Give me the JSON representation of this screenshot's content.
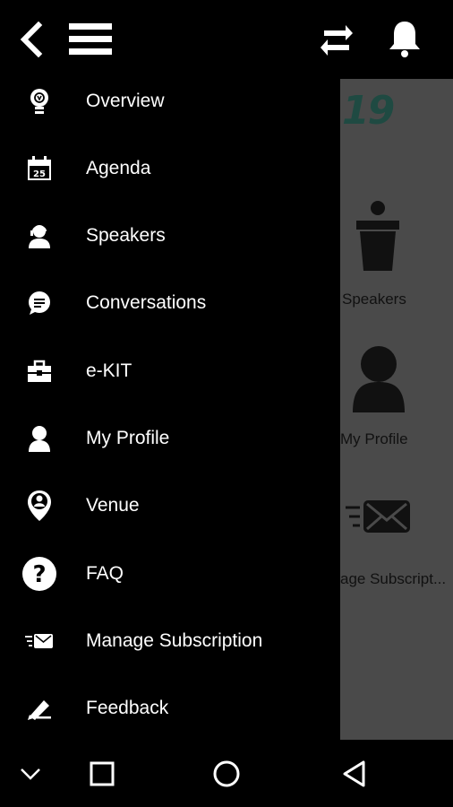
{
  "colors": {
    "background": "#000000",
    "drawer": "#000000",
    "overlay_content": "#4a4a4a",
    "text": "#ffffff",
    "accent_logo": "#1f4a42"
  },
  "topbar": {
    "icons": [
      "back-arrow-icon",
      "hamburger-menu-icon",
      "sync-icon",
      "bell-icon"
    ]
  },
  "drawer": {
    "items": [
      {
        "label": "Overview",
        "icon": "lightbulb-icon"
      },
      {
        "label": "Agenda",
        "icon": "calendar-icon"
      },
      {
        "label": "Speakers",
        "icon": "speaker-icon"
      },
      {
        "label": "Conversations",
        "icon": "chat-bubble-icon"
      },
      {
        "label": "e-KIT",
        "icon": "briefcase-icon"
      },
      {
        "label": "My Profile",
        "icon": "person-icon"
      },
      {
        "label": "Venue",
        "icon": "map-pin-icon"
      },
      {
        "label": "FAQ",
        "icon": "question-icon"
      },
      {
        "label": "Manage Subscription",
        "icon": "envelope-icon"
      },
      {
        "label": "Feedback",
        "icon": "feedback-pen-icon"
      }
    ],
    "calendar_day": "25"
  },
  "background": {
    "logo_text": "19",
    "tiles": [
      {
        "label": "Speakers"
      },
      {
        "label": "My Profile"
      },
      {
        "label": "age Subscript..."
      }
    ]
  },
  "navbar": {
    "icons": [
      "collapse-chevron-icon",
      "recents-square-icon",
      "home-circle-icon",
      "back-triangle-icon"
    ]
  }
}
